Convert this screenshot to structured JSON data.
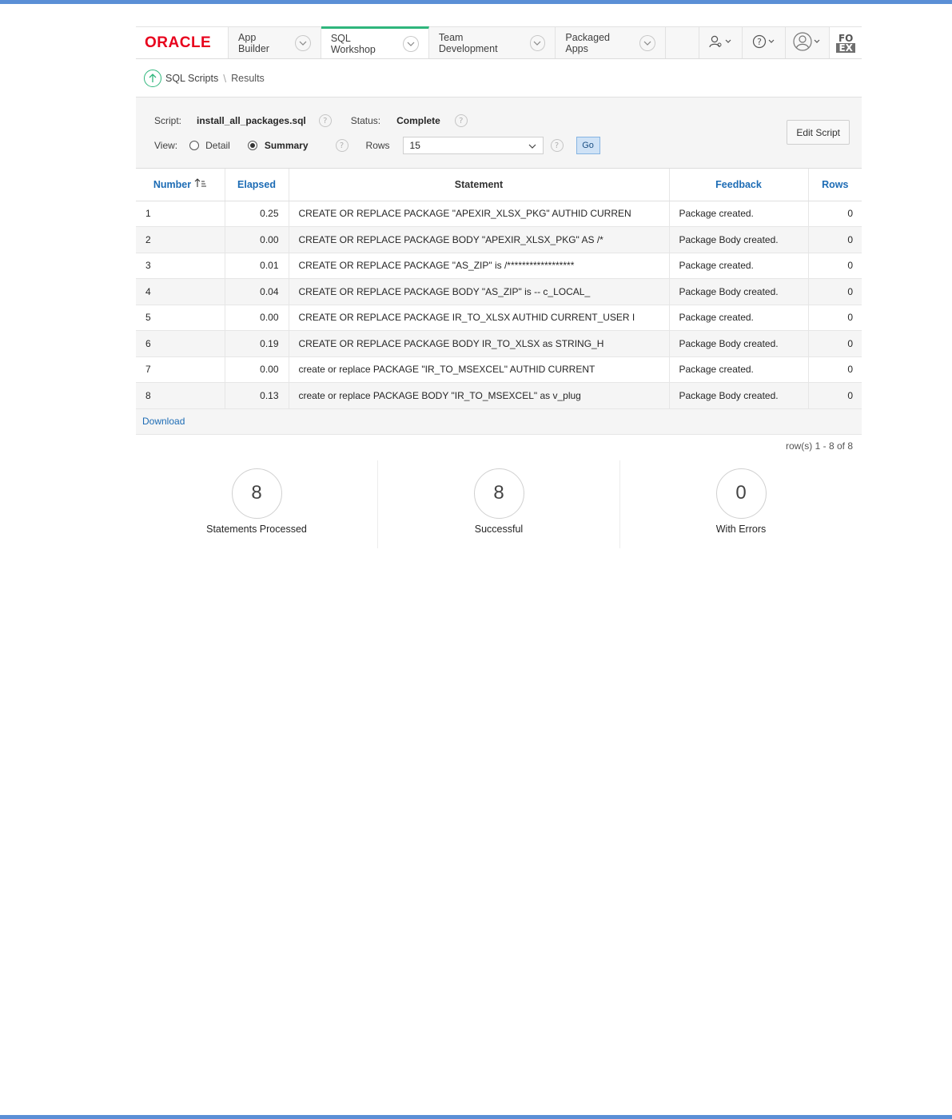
{
  "brand": {
    "logo_text": "ORACLE",
    "logo_color": "#e8001c",
    "accent": "#2fb67c",
    "link_color": "#1d6cb5"
  },
  "nav": {
    "tabs": [
      {
        "label": "App Builder",
        "active": false
      },
      {
        "label": "SQL Workshop",
        "active": true
      },
      {
        "label": "Team Development",
        "active": false
      },
      {
        "label": "Packaged Apps",
        "active": false
      }
    ],
    "icons": [
      "admin-icon",
      "help-icon",
      "user-icon"
    ],
    "fo_logo": {
      "top": "FO",
      "bottom": "EX"
    }
  },
  "breadcrumb": {
    "parent": "SQL Scripts",
    "separator": "\\",
    "current": "Results"
  },
  "panel": {
    "script_label": "Script:",
    "script_value": "install_all_packages.sql",
    "status_label": "Status:",
    "status_value": "Complete",
    "view_label": "View:",
    "view_options": [
      {
        "label": "Detail",
        "selected": false
      },
      {
        "label": "Summary",
        "selected": true
      }
    ],
    "rows_label": "Rows",
    "rows_value": "15",
    "go_label": "Go",
    "edit_label": "Edit Script"
  },
  "table": {
    "headers": {
      "number": "Number",
      "elapsed": "Elapsed",
      "statement": "Statement",
      "feedback": "Feedback",
      "rows": "Rows"
    },
    "rows": [
      {
        "number": "1",
        "elapsed": "0.25",
        "statement": "CREATE OR REPLACE PACKAGE \"APEXIR_XLSX_PKG\" AUTHID CURREN",
        "feedback": "Package created.",
        "rows": "0"
      },
      {
        "number": "2",
        "elapsed": "0.00",
        "statement": "CREATE OR REPLACE PACKAGE BODY \"APEXIR_XLSX_PKG\" AS /*",
        "feedback": "Package Body created.",
        "rows": "0"
      },
      {
        "number": "3",
        "elapsed": "0.01",
        "statement": "CREATE OR REPLACE PACKAGE \"AS_ZIP\" is /******************",
        "feedback": "Package created.",
        "rows": "0"
      },
      {
        "number": "4",
        "elapsed": "0.04",
        "statement": "CREATE OR REPLACE PACKAGE BODY \"AS_ZIP\" is -- c_LOCAL_",
        "feedback": "Package Body created.",
        "rows": "0"
      },
      {
        "number": "5",
        "elapsed": "0.00",
        "statement": "CREATE OR REPLACE PACKAGE IR_TO_XLSX AUTHID CURRENT_USER I",
        "feedback": "Package created.",
        "rows": "0"
      },
      {
        "number": "6",
        "elapsed": "0.19",
        "statement": "CREATE OR REPLACE PACKAGE BODY IR_TO_XLSX as STRING_H",
        "feedback": "Package Body created.",
        "rows": "0"
      },
      {
        "number": "7",
        "elapsed": "0.00",
        "statement": "create or replace PACKAGE \"IR_TO_MSEXCEL\" AUTHID CURRENT",
        "feedback": "Package created.",
        "rows": "0"
      },
      {
        "number": "8",
        "elapsed": "0.13",
        "statement": "create or replace PACKAGE BODY \"IR_TO_MSEXCEL\" as v_plug",
        "feedback": "Package Body created.",
        "rows": "0"
      }
    ],
    "download_label": "Download",
    "pagination": "row(s) 1 - 8 of 8"
  },
  "summary": [
    {
      "value": "8",
      "label": "Statements Processed"
    },
    {
      "value": "8",
      "label": "Successful"
    },
    {
      "value": "0",
      "label": "With Errors"
    }
  ]
}
